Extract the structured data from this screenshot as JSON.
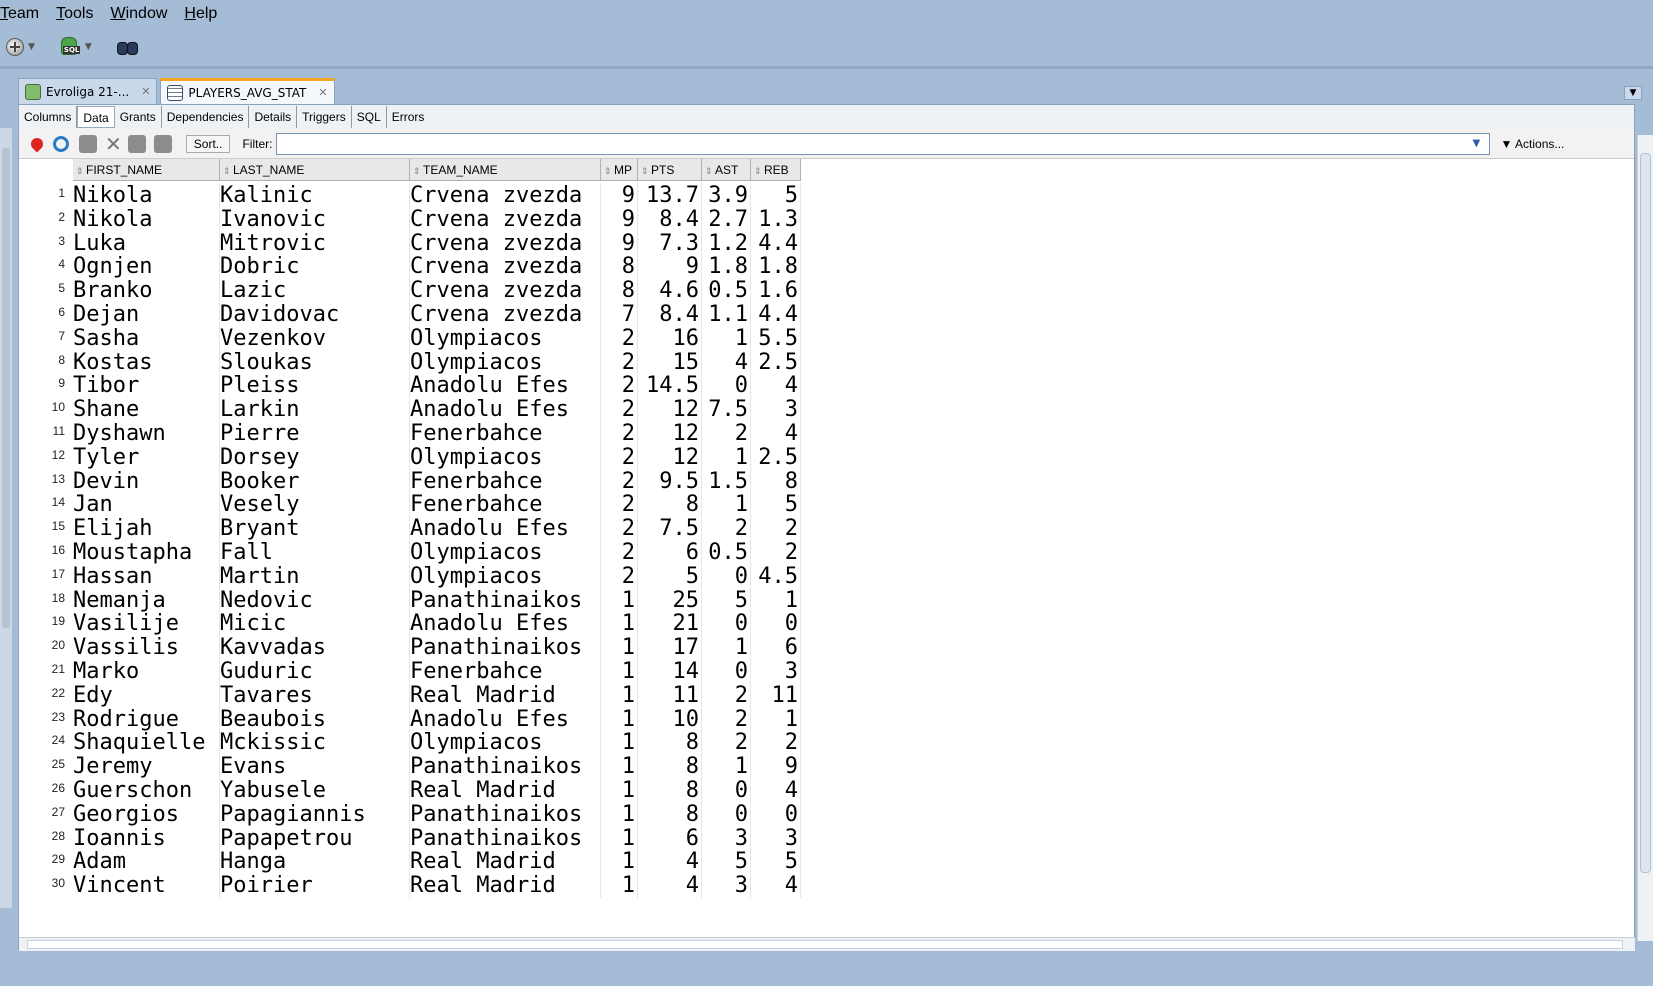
{
  "menu": [
    "Team",
    "Tools",
    "Window",
    "Help"
  ],
  "menu_underline": [
    "T",
    "T",
    "W",
    "H"
  ],
  "tabs": [
    {
      "label": "Evroliga 21-...",
      "icon": "sql-worksheet-icon"
    },
    {
      "label": "PLAYERS_AVG_STAT",
      "icon": "table-icon"
    }
  ],
  "subtabs": [
    "Columns",
    "Data",
    "Grants",
    "Dependencies",
    "Details",
    "Triggers",
    "SQL",
    "Errors"
  ],
  "active_subtab": "Data",
  "datatoolbar": {
    "sort_label": "Sort..",
    "filter_label": "Filter:",
    "filter_value": "",
    "actions_label": "Actions..."
  },
  "columns": [
    "FIRST_NAME",
    "LAST_NAME",
    "TEAM_NAME",
    "MP",
    "PTS",
    "AST",
    "REB"
  ],
  "rows": [
    [
      "1",
      "Nikola",
      "Kalinic",
      "Crvena zvezda",
      "9",
      "13.7",
      "3.9",
      "5"
    ],
    [
      "2",
      "Nikola",
      "Ivanovic",
      "Crvena zvezda",
      "9",
      "8.4",
      "2.7",
      "1.3"
    ],
    [
      "3",
      "Luka",
      "Mitrovic",
      "Crvena zvezda",
      "9",
      "7.3",
      "1.2",
      "4.4"
    ],
    [
      "4",
      "Ognjen",
      "Dobric",
      "Crvena zvezda",
      "8",
      "9",
      "1.8",
      "1.8"
    ],
    [
      "5",
      "Branko",
      "Lazic",
      "Crvena zvezda",
      "8",
      "4.6",
      "0.5",
      "1.6"
    ],
    [
      "6",
      "Dejan",
      "Davidovac",
      "Crvena zvezda",
      "7",
      "8.4",
      "1.1",
      "4.4"
    ],
    [
      "7",
      "Sasha",
      "Vezenkov",
      "Olympiacos",
      "2",
      "16",
      "1",
      "5.5"
    ],
    [
      "8",
      "Kostas",
      "Sloukas",
      "Olympiacos",
      "2",
      "15",
      "4",
      "2.5"
    ],
    [
      "9",
      "Tibor",
      "Pleiss",
      "Anadolu Efes",
      "2",
      "14.5",
      "0",
      "4"
    ],
    [
      "10",
      "Shane",
      "Larkin",
      "Anadolu Efes",
      "2",
      "12",
      "7.5",
      "3"
    ],
    [
      "11",
      "Dyshawn",
      "Pierre",
      "Fenerbahce",
      "2",
      "12",
      "2",
      "4"
    ],
    [
      "12",
      "Tyler",
      "Dorsey",
      "Olympiacos",
      "2",
      "12",
      "1",
      "2.5"
    ],
    [
      "13",
      "Devin",
      "Booker",
      "Fenerbahce",
      "2",
      "9.5",
      "1.5",
      "8"
    ],
    [
      "14",
      "Jan",
      "Vesely",
      "Fenerbahce",
      "2",
      "8",
      "1",
      "5"
    ],
    [
      "15",
      "Elijah",
      "Bryant",
      "Anadolu Efes",
      "2",
      "7.5",
      "2",
      "2"
    ],
    [
      "16",
      "Moustapha",
      "Fall",
      "Olympiacos",
      "2",
      "6",
      "0.5",
      "2"
    ],
    [
      "17",
      "Hassan",
      "Martin",
      "Olympiacos",
      "2",
      "5",
      "0",
      "4.5"
    ],
    [
      "18",
      "Nemanja",
      "Nedovic",
      "Panathinaikos",
      "1",
      "25",
      "5",
      "1"
    ],
    [
      "19",
      "Vasilije",
      "Micic",
      "Anadolu Efes",
      "1",
      "21",
      "0",
      "0"
    ],
    [
      "20",
      "Vassilis",
      "Kavvadas",
      "Panathinaikos",
      "1",
      "17",
      "1",
      "6"
    ],
    [
      "21",
      "Marko",
      "Guduric",
      "Fenerbahce",
      "1",
      "14",
      "0",
      "3"
    ],
    [
      "22",
      "Edy",
      "Tavares",
      "Real Madrid",
      "1",
      "11",
      "2",
      "11"
    ],
    [
      "23",
      "Rodrigue",
      "Beaubois",
      "Anadolu Efes",
      "1",
      "10",
      "2",
      "1"
    ],
    [
      "24",
      "Shaquielle",
      "Mckissic",
      "Olympiacos",
      "1",
      "8",
      "2",
      "2"
    ],
    [
      "25",
      "Jeremy",
      "Evans",
      "Panathinaikos",
      "1",
      "8",
      "1",
      "9"
    ],
    [
      "26",
      "Guerschon",
      "Yabusele",
      "Real Madrid",
      "1",
      "8",
      "0",
      "4"
    ],
    [
      "27",
      "Georgios",
      "Papagiannis",
      "Panathinaikos",
      "1",
      "8",
      "0",
      "0"
    ],
    [
      "28",
      "Ioannis",
      "Papapetrou",
      "Panathinaikos",
      "1",
      "6",
      "3",
      "3"
    ],
    [
      "29",
      "Adam",
      "Hanga",
      "Real Madrid",
      "1",
      "4",
      "5",
      "5"
    ],
    [
      "30",
      "Vincent",
      "Poirier",
      "Real Madrid",
      "1",
      "4",
      "3",
      "4"
    ]
  ]
}
